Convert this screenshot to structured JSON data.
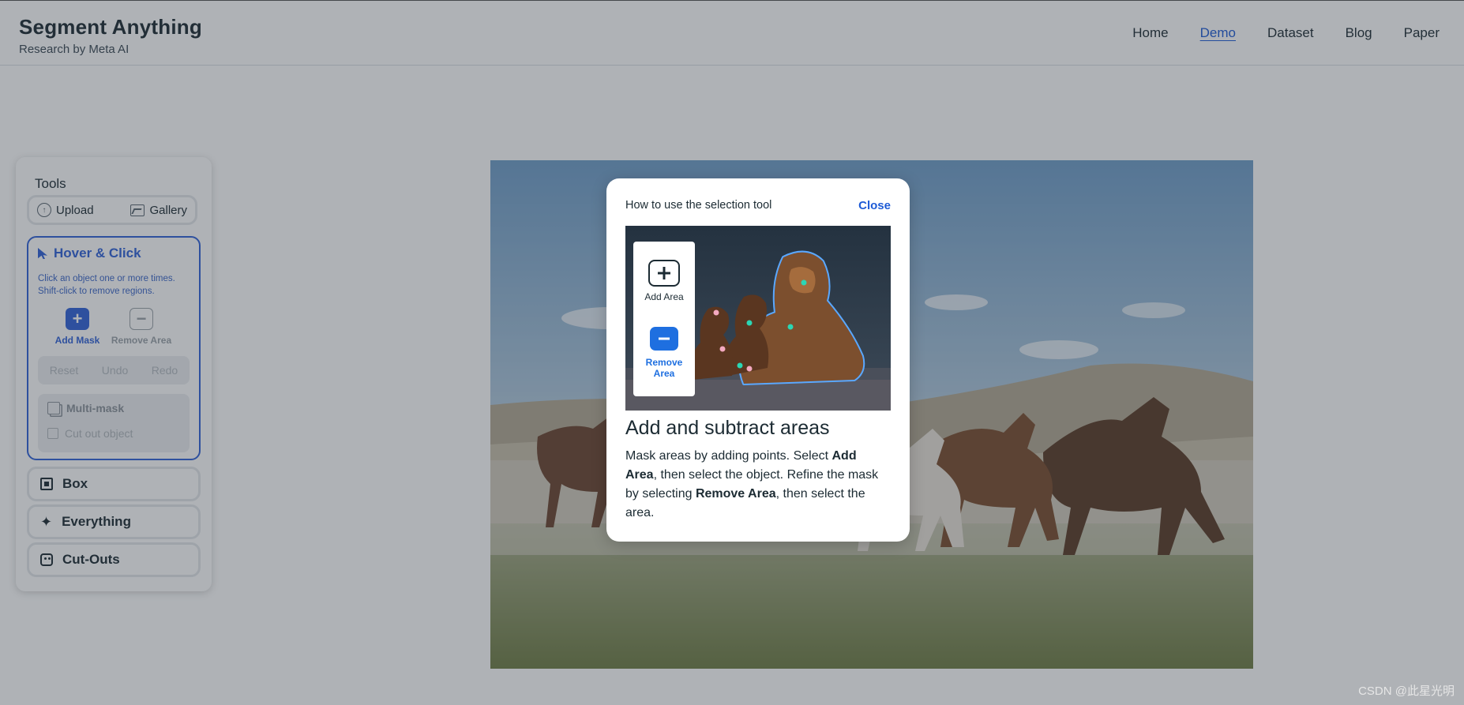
{
  "header": {
    "title": "Segment Anything",
    "subtitle": "Research by Meta AI",
    "nav": [
      "Home",
      "Demo",
      "Dataset",
      "Blog",
      "Paper"
    ],
    "active_nav": "Demo"
  },
  "tools": {
    "title": "Tools",
    "upload": "Upload",
    "gallery": "Gallery",
    "hover_click": {
      "title": "Hover & Click",
      "description": "Click an object one or more times. Shift-click to remove regions.",
      "add_mask": "Add Mask",
      "remove_area": "Remove Area",
      "reset": "Reset",
      "undo": "Undo",
      "redo": "Redo",
      "multi_mask": "Multi-mask",
      "cut_out": "Cut out object"
    },
    "box": "Box",
    "everything": "Everything",
    "cut_outs": "Cut-Outs"
  },
  "modal": {
    "heading": "How to use the selection tool",
    "close": "Close",
    "illustration": {
      "add_area": "Add Area",
      "remove_area": "Remove Area"
    },
    "title": "Add and subtract areas",
    "body": {
      "p1": "Mask areas by adding points. Select ",
      "b1": "Add Area",
      "p2": ", then select the object. Refine the mask by selecting ",
      "b2": "Remove Area",
      "p3": ", then select the area."
    }
  },
  "watermark": "CSDN @此星光明",
  "colors": {
    "accent": "#2f62d8",
    "link": "#1e5bd6",
    "overlay": "#2c3440"
  }
}
